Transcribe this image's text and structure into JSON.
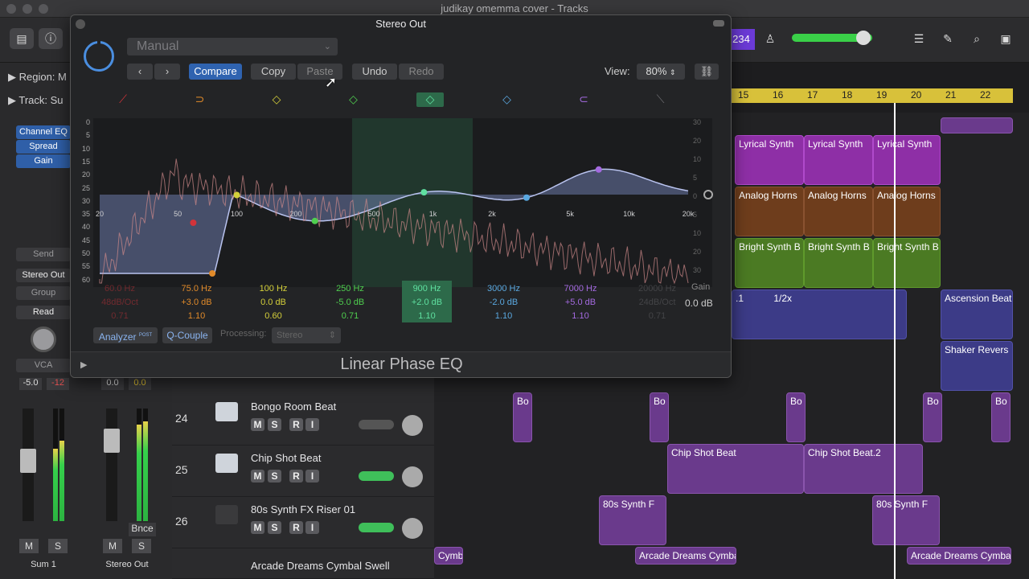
{
  "window": {
    "title": "judikay omemma cover - Tracks"
  },
  "toolbar": {
    "lcd": "234"
  },
  "inspector": {
    "region_label": "Region:",
    "region_value": "M",
    "track_label": "Track:",
    "track_value": "Su",
    "plugins": [
      "Channel EQ",
      "Spread",
      "Gain"
    ],
    "send": "Send",
    "output": "Stereo Out",
    "group": "Group",
    "automation": "Read",
    "vca": "VCA",
    "ch1": {
      "vol": "-5.0",
      "peak": "-12",
      "name": "Sum 1"
    },
    "ch2": {
      "vol": "0.0",
      "peak": "0.0",
      "name": "Stereo Out",
      "bnce": "Bnce"
    },
    "m": "M",
    "s": "S"
  },
  "tracks": [
    {
      "num": "24",
      "name": "Bongo Room Beat"
    },
    {
      "num": "25",
      "name": "Chip Shot Beat"
    },
    {
      "num": "26",
      "name": "80s Synth FX Riser 01"
    },
    {
      "num": "",
      "name": "Arcade Dreams Cymbal Swell"
    }
  ],
  "track_buttons": {
    "m": "M",
    "s": "S",
    "r": "R",
    "i": "I"
  },
  "ruler": [
    "15",
    "16",
    "17",
    "18",
    "19",
    "20",
    "21",
    "22"
  ],
  "regions": {
    "lyrical": "Lyrical Synth",
    "horns": "Analog Horns",
    "bright": "Bright Synth B",
    "loop": ".1",
    "loop_rate": "1/2x",
    "ascension": "Ascension Beat",
    "shaker": "Shaker Revers",
    "bo": "Bo",
    "chip1": "Chip Shot Beat",
    "chip2": "Chip Shot Beat.2",
    "riser": "80s Synth F",
    "cymba_left": "Cymba",
    "arcade": "Arcade Dreams Cymba"
  },
  "eq": {
    "title": "Stereo Out",
    "preset": "Manual",
    "compare": "Compare",
    "copy": "Copy",
    "paste": "Paste",
    "undo": "Undo",
    "redo": "Redo",
    "view_label": "View:",
    "view_value": "80%",
    "freq_ticks": [
      "20",
      "50",
      "100",
      "200",
      "500",
      "1k",
      "2k",
      "5k",
      "10k",
      "20k"
    ],
    "db_left": [
      "0",
      "5",
      "10",
      "15",
      "20",
      "25",
      "30",
      "35",
      "40",
      "45",
      "50",
      "55",
      "60"
    ],
    "db_right": [
      "30",
      "20",
      "10",
      "5",
      "0",
      "5",
      "10",
      "20",
      "30"
    ],
    "bands": [
      {
        "freq": "60.0 Hz",
        "gain": "48dB/Oct",
        "q": "0.71",
        "color": "#d2333a"
      },
      {
        "freq": "75.0 Hz",
        "gain": "+3.0 dB",
        "q": "1.10",
        "color": "#e08a2a"
      },
      {
        "freq": "100 Hz",
        "gain": "0.0 dB",
        "q": "0.60",
        "color": "#d4cf3a"
      },
      {
        "freq": "250 Hz",
        "gain": "-5.0 dB",
        "q": "0.71",
        "color": "#4fcf4f"
      },
      {
        "freq": "900 Hz",
        "gain": "+2.0 dB",
        "q": "1.10",
        "color": "#5fe0a0"
      },
      {
        "freq": "3000 Hz",
        "gain": "-2.0 dB",
        "q": "1.10",
        "color": "#5aa8e0"
      },
      {
        "freq": "7000 Hz",
        "gain": "+5.0 dB",
        "q": "1.10",
        "color": "#a46ae0"
      },
      {
        "freq": "20000 Hz",
        "gain": "24dB/Oct",
        "q": "0.71",
        "color": "#6a6a6e"
      }
    ],
    "gain_label": "Gain",
    "gain_value": "0.0 dB",
    "analyzer": "Analyzer",
    "analyzer_tag": "POST",
    "qcouple": "Q-Couple",
    "processing_label": "Processing:",
    "processing_value": "Stereo",
    "plugin_name": "Linear Phase EQ"
  }
}
